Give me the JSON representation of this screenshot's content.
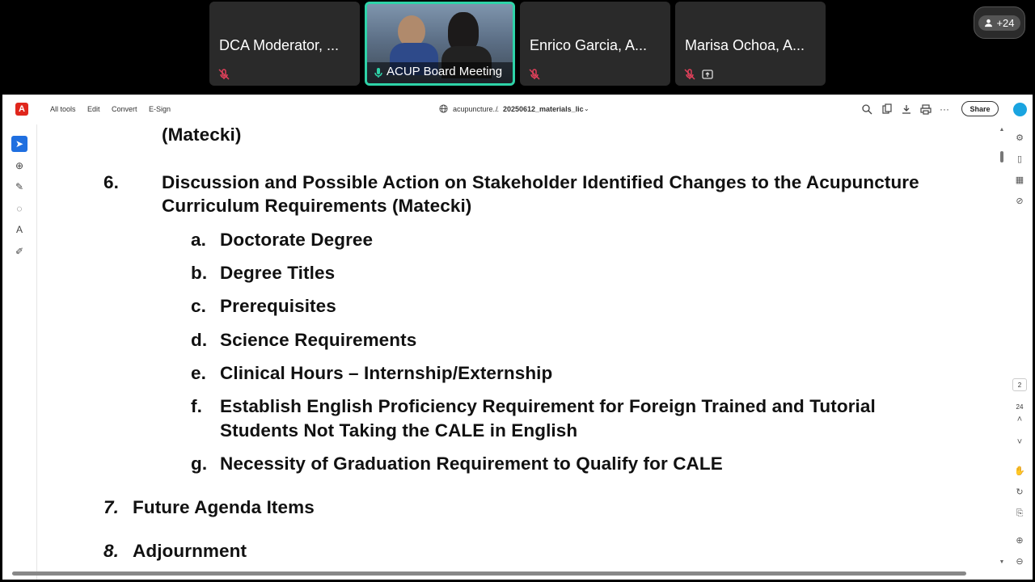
{
  "meeting": {
    "tiles": [
      {
        "name": "DCA Moderator, ..."
      },
      {
        "name": "ACUP Board Meeting"
      },
      {
        "name": "Enrico Garcia, A..."
      },
      {
        "name": "Marisa Ochoa, A..."
      }
    ],
    "participants_count": "+24"
  },
  "toolbar": {
    "menu": [
      "All tools",
      "Edit",
      "Convert",
      "E-Sign"
    ],
    "breadcrumb_site": "acupuncture...",
    "breadcrumb_sep": "/",
    "breadcrumb_file": "20250612_materials_lic",
    "share_label": "Share"
  },
  "page_nav": {
    "current": "2",
    "total": "24"
  },
  "document": {
    "top_line": "(Matecki)",
    "item6": {
      "number": "6.",
      "line1": "Discussion and Possible Action on Stakeholder Identified Changes to the Acupuncture",
      "line2": "Curriculum Requirements (Matecki)",
      "subitems": [
        {
          "letter": "a.",
          "text": "Doctorate Degree"
        },
        {
          "letter": "b.",
          "text": "Degree Titles"
        },
        {
          "letter": "c.",
          "text": "Prerequisites"
        },
        {
          "letter": "d.",
          "text": "Science Requirements"
        },
        {
          "letter": "e.",
          "text": "Clinical Hours – Internship/Externship"
        },
        {
          "letter": "f.",
          "text": "Establish English Proficiency Requirement for Foreign Trained and Tutorial",
          "text2": "Students Not Taking the CALE in English"
        },
        {
          "letter": "g.",
          "text": "Necessity of Graduation Requirement to Qualify for CALE"
        }
      ]
    },
    "item7": {
      "number": "7.",
      "text": "Future Agenda Items"
    },
    "item8": {
      "number": "8.",
      "text": "Adjournment"
    }
  }
}
